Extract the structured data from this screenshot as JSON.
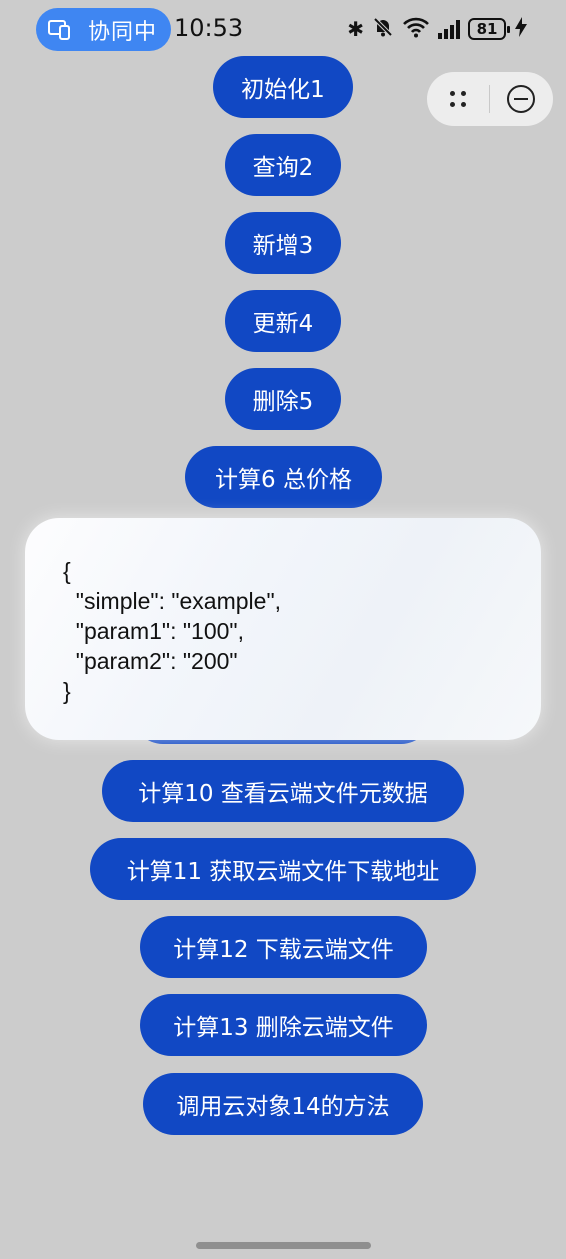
{
  "status_bar": {
    "collab_label": "协同中",
    "time": "10:53",
    "battery": "81",
    "icons": [
      "bluetooth-icon",
      "mute-bell-icon",
      "wifi-icon",
      "signal-icon",
      "battery-icon",
      "charging-icon"
    ]
  },
  "capsule": {
    "more_icon": "more-dots-icon",
    "close_icon": "close-circle-icon"
  },
  "buttons": {
    "init": "初始化1",
    "query": "查询2",
    "add": "新增3",
    "update": "更新4",
    "delete": "删除5",
    "calc6": "计算6 总价格",
    "calc10": "计算10 查看云端文件元数据",
    "calc11": "计算11 获取云端文件下载地址",
    "calc12": "计算12 下载云端文件",
    "calc13": "计算13 删除云端文件",
    "call14": "调用云对象14的方法"
  },
  "popup": {
    "json_text": "{\n  \"simple\": \"example\",\n  \"param1\": \"100\",\n  \"param2\": \"200\"\n}"
  },
  "colors": {
    "accent": "#1148c4",
    "background": "#cccccc",
    "collab": "#3f86f2"
  }
}
